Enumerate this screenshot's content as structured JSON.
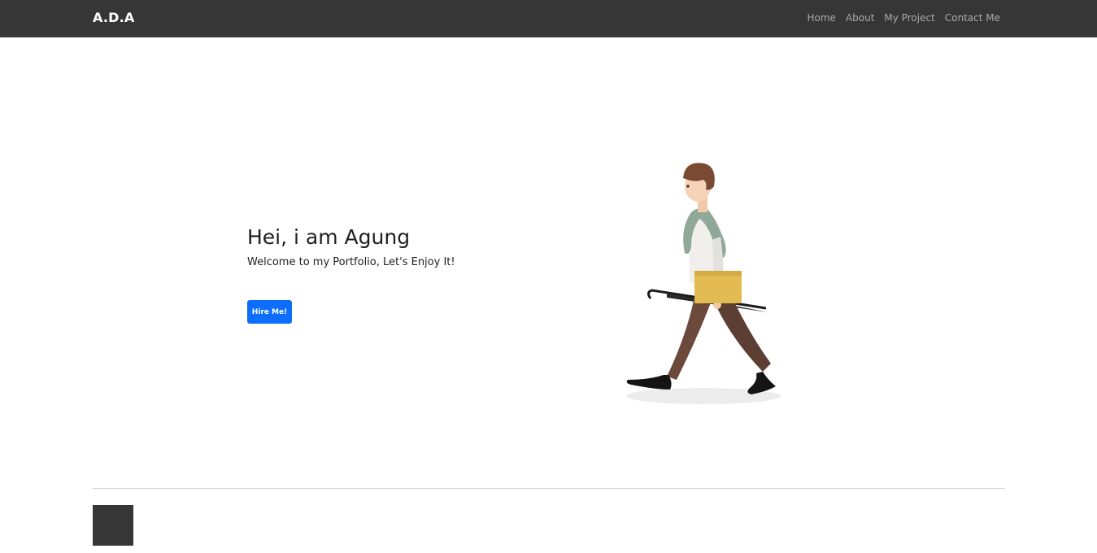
{
  "navbar": {
    "brand": "A.D.A",
    "links": [
      "Home",
      "About",
      "My Project",
      "Contact Me"
    ]
  },
  "hero": {
    "title": "Hei, i am Agung",
    "subtitle": "Welcome to my Portfolio, Let's Enjoy It!",
    "button_label": "Hire Me!"
  },
  "colors": {
    "navbar_bg": "#363636",
    "button_bg": "#0d6efd",
    "nav_link": "#a9a9a9"
  },
  "icons": {
    "illustration": "walking-person-illustration",
    "section_block": "dark-square-block"
  }
}
